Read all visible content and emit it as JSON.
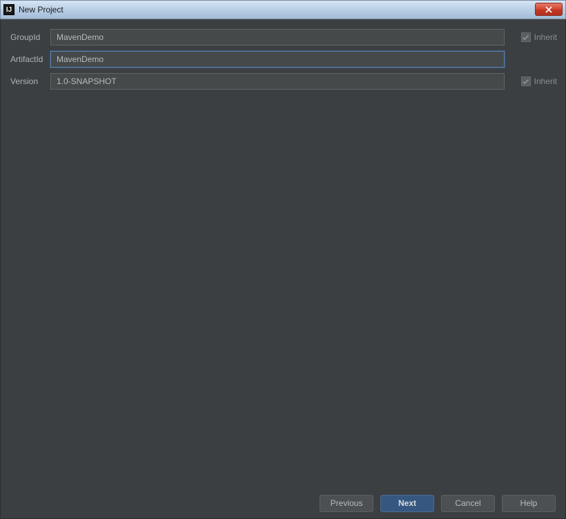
{
  "window": {
    "title": "New Project"
  },
  "form": {
    "groupId": {
      "label": "GroupId",
      "value": "MavenDemo",
      "inherit_label": "Inherit",
      "inherit_checked": true
    },
    "artifactId": {
      "label": "ArtifactId",
      "value": "MavenDemo"
    },
    "version": {
      "label": "Version",
      "value": "1.0-SNAPSHOT",
      "inherit_label": "Inherit",
      "inherit_checked": true
    }
  },
  "buttons": {
    "previous": "Previous",
    "next": "Next",
    "cancel": "Cancel",
    "help": "Help"
  }
}
